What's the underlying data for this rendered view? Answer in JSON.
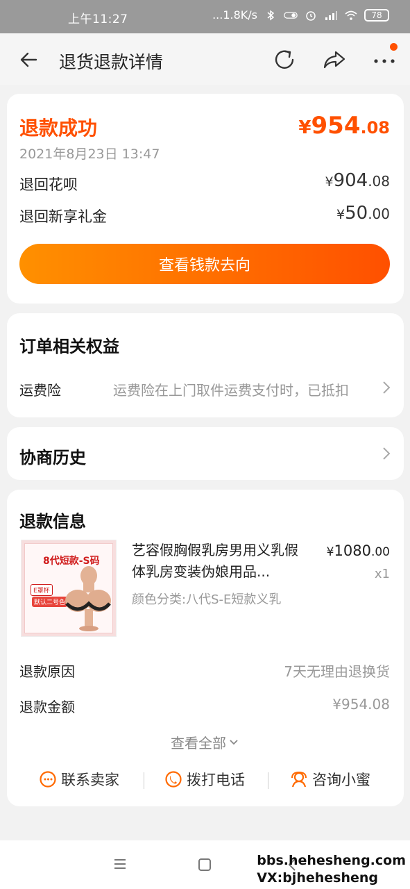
{
  "status_bar": {
    "time": "上午11:27",
    "net_speed": "...1.8K/s",
    "battery": "78"
  },
  "nav": {
    "title": "退货退款详情"
  },
  "refund_summary": {
    "status": "退款成功",
    "amount_symbol": "¥",
    "amount_int": "954",
    "amount_dec": ".08",
    "date": "2021年8月23日 13:47",
    "rows": [
      {
        "label": "退回花呗",
        "symbol": "¥",
        "int": "904",
        "dec": ".08"
      },
      {
        "label": "退回新享礼金",
        "symbol": "¥",
        "int": "50",
        "dec": ".00"
      }
    ],
    "cta_label": "查看钱款去向"
  },
  "rights": {
    "title": "订单相关权益",
    "item_label": "运费险",
    "item_value": "运费险在上门取件运费支付时，已抵扣"
  },
  "history": {
    "title": "协商历史"
  },
  "refund_info": {
    "title": "退款信息",
    "product": {
      "thumb_tag": "8代短款-S码",
      "thumb_cup": "E罩杯",
      "thumb_color": "默认二号色",
      "title": "艺容假胸假乳房男用义乳假体乳房变装伪娘用品...",
      "sku": "颜色分类:八代S-E短款义乳",
      "price_symbol": "¥",
      "price_int": "1080",
      "price_dec": ".00",
      "qty": "x1"
    },
    "reason_label": "退款原因",
    "reason_value": "7天无理由退换货",
    "amount_label": "退款金额",
    "amount_value": "¥954.08",
    "see_all": "查看全部",
    "actions": [
      "联系卖家",
      "拨打电话",
      "咨询小蜜"
    ]
  },
  "watermark": {
    "line1": "bbs.hehesheng.com",
    "line2": "VX:bjhehesheng"
  },
  "colors": {
    "accent": "#ff5000",
    "accent_start": "#ff9000"
  }
}
